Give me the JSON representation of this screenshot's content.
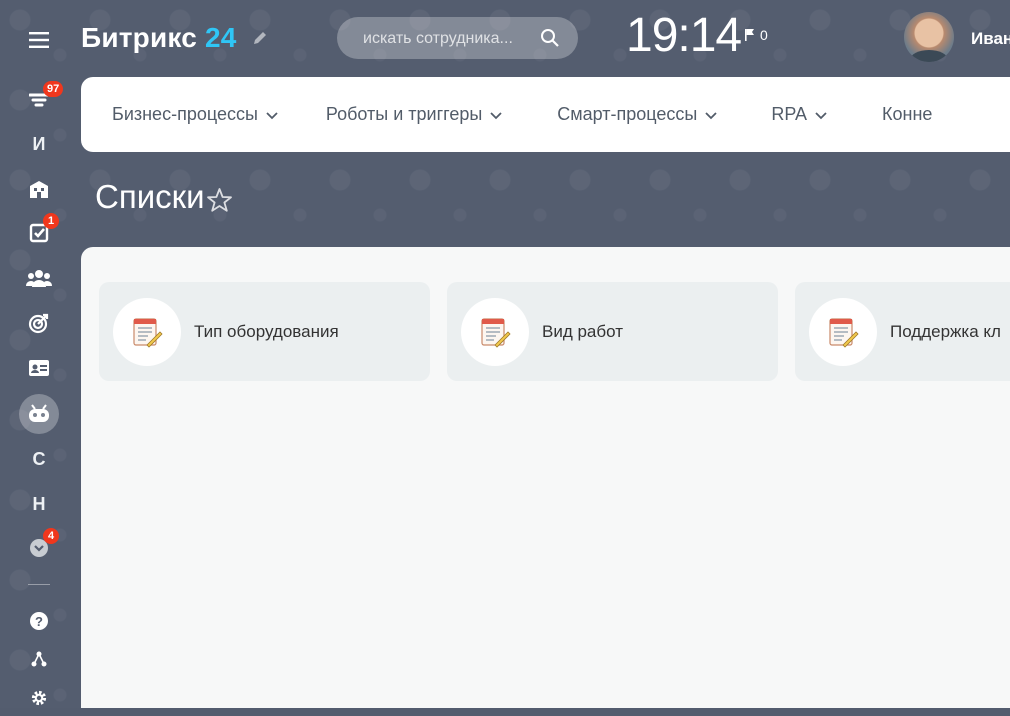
{
  "header": {
    "logo_name": "Битрикс",
    "logo_number": "24",
    "search_placeholder": "искать сотрудника...",
    "clock": "19:14",
    "flag_count": "0",
    "user_name": "Иван"
  },
  "left_menu": {
    "items": [
      {
        "name": "feed",
        "icon": "filter-icon",
        "badge": "97"
      },
      {
        "name": "I",
        "letter": "И"
      },
      {
        "name": "company",
        "icon": "building-icon"
      },
      {
        "name": "tasks",
        "icon": "checkbox-icon",
        "badge": "1"
      },
      {
        "name": "employees",
        "icon": "people-icon"
      },
      {
        "name": "goals",
        "icon": "target-icon"
      },
      {
        "name": "contacts",
        "icon": "id-card-icon"
      },
      {
        "name": "automation",
        "icon": "robot-icon",
        "active": true
      },
      {
        "name": "S",
        "letter": "С"
      },
      {
        "name": "N",
        "letter": "Н"
      },
      {
        "name": "more",
        "icon": "chevron-down-icon",
        "badge": "4"
      },
      {
        "name": "help",
        "icon": "question-icon"
      },
      {
        "name": "structure",
        "icon": "hierarchy-icon"
      },
      {
        "name": "settings",
        "icon": "gear-icon"
      }
    ]
  },
  "top_nav": {
    "items": [
      {
        "label": "Бизнес-процессы"
      },
      {
        "label": "Роботы и триггеры"
      },
      {
        "label": "Смарт-процессы"
      },
      {
        "label": "RPA"
      },
      {
        "label": "Конне"
      }
    ]
  },
  "page": {
    "title": "Списки"
  },
  "lists": [
    {
      "label": "Тип оборудования",
      "icon": "list-document-icon"
    },
    {
      "label": "Вид работ",
      "icon": "list-document-icon"
    },
    {
      "label": "Поддержка кл",
      "icon": "list-document-icon"
    }
  ],
  "colors": {
    "accent": "#2fc6f6",
    "badge": "#f0371d",
    "background": "#545d6f",
    "panel": "#f7f8f8",
    "tile": "#ebeff0"
  }
}
